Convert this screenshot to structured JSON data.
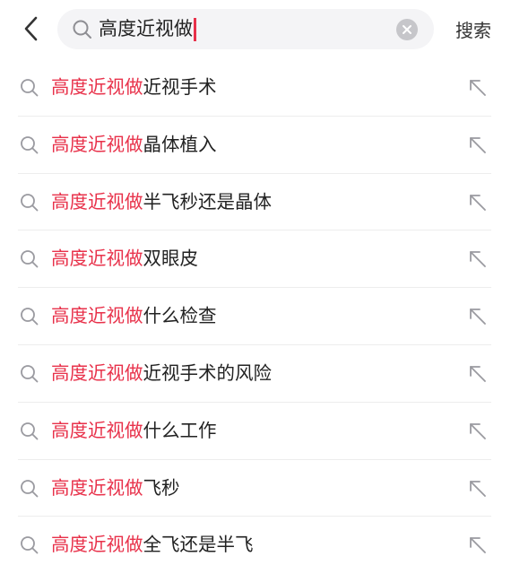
{
  "header": {
    "search_query": "高度近视做",
    "search_button_label": "搜索"
  },
  "suggestions": [
    {
      "match": "高度近视做",
      "rest": "近视手术"
    },
    {
      "match": "高度近视做",
      "rest": "晶体植入"
    },
    {
      "match": "高度近视做",
      "rest": "半飞秒还是晶体"
    },
    {
      "match": "高度近视做",
      "rest": "双眼皮"
    },
    {
      "match": "高度近视做",
      "rest": "什么检查"
    },
    {
      "match": "高度近视做",
      "rest": "近视手术的风险"
    },
    {
      "match": "高度近视做",
      "rest": "什么工作"
    },
    {
      "match": "高度近视做",
      "rest": "飞秒"
    },
    {
      "match": "高度近视做",
      "rest": "全飞还是半飞"
    }
  ],
  "icons": {
    "back": "back-chevron-icon",
    "search": "search-icon",
    "clear": "clear-icon",
    "fill": "arrow-up-left-icon"
  },
  "colors": {
    "highlight": "#e8314a",
    "text": "#222222",
    "search_box_bg": "#f4f4f6"
  }
}
